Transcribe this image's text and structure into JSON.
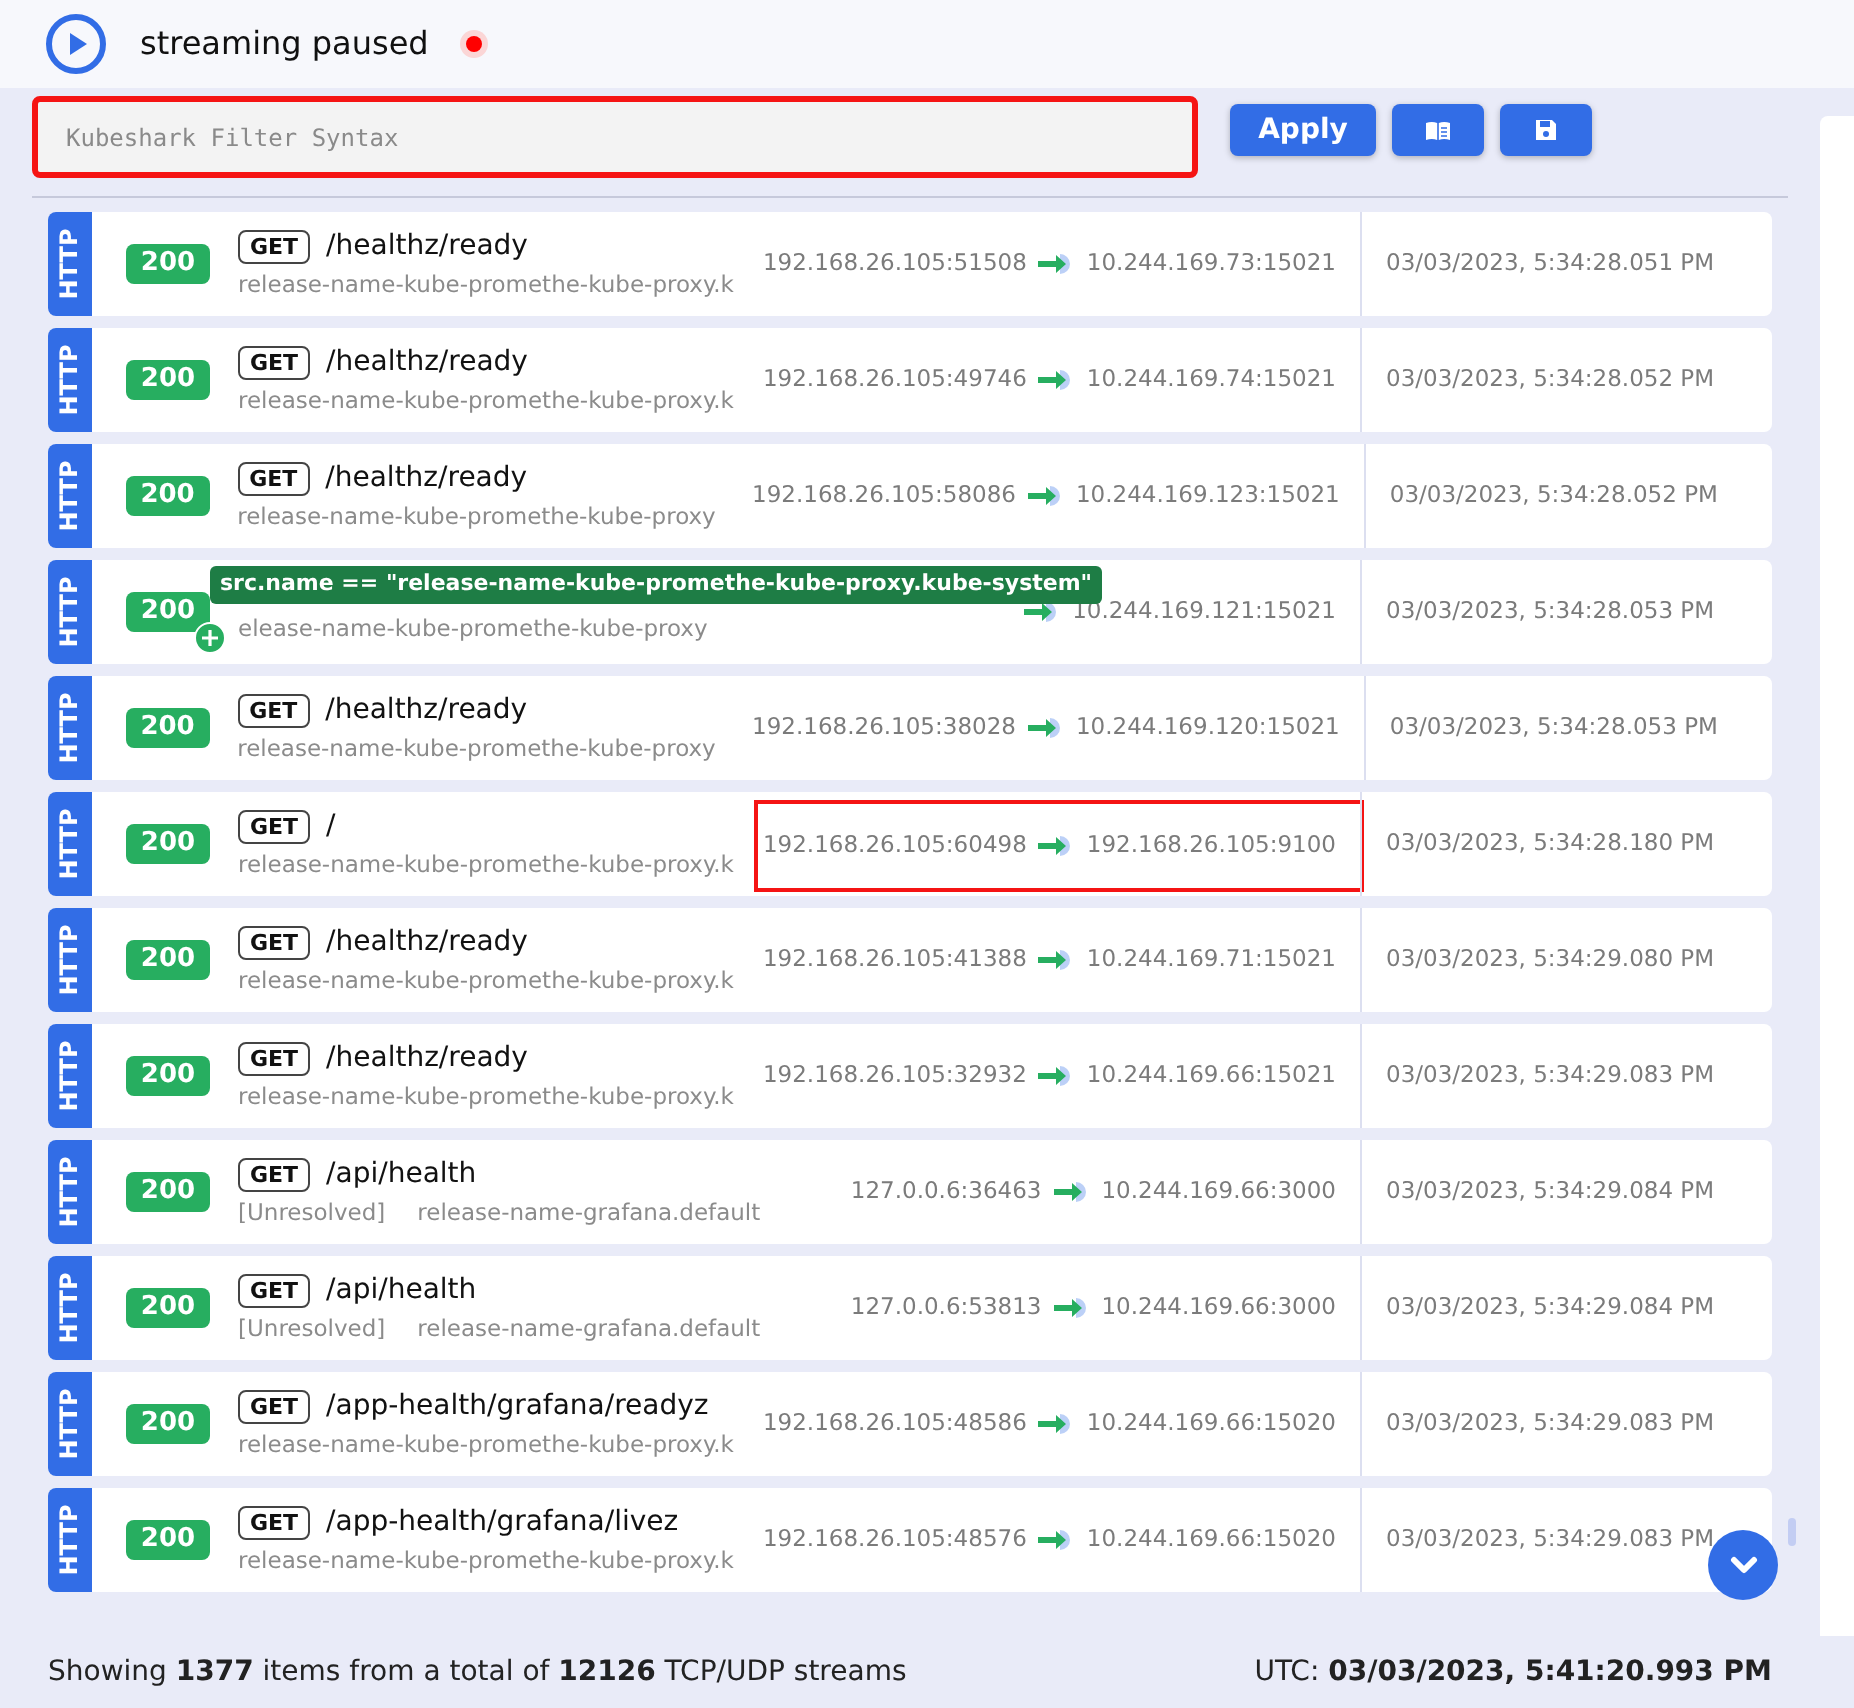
{
  "header": {
    "status_text": "streaming paused",
    "recording": true
  },
  "filter": {
    "placeholder": "Kubeshark Filter Syntax",
    "highlighted": true,
    "apply_label": "Apply"
  },
  "entries": [
    {
      "protocol": "HTTP",
      "status": "200",
      "method": "GET",
      "path": "/healthz/ready",
      "source_name": "release-name-kube-promethe-kube-proxy.k",
      "src_addr": "192.168.26.105:51508",
      "dst_addr": "10.244.169.73:15021",
      "timestamp": "03/03/2023, 5:34:28.051 PM"
    },
    {
      "protocol": "HTTP",
      "status": "200",
      "method": "GET",
      "path": "/healthz/ready",
      "source_name": "release-name-kube-promethe-kube-proxy.k",
      "src_addr": "192.168.26.105:49746",
      "dst_addr": "10.244.169.74:15021",
      "timestamp": "03/03/2023, 5:34:28.052 PM"
    },
    {
      "protocol": "HTTP",
      "status": "200",
      "method": "GET",
      "path": "/healthz/ready",
      "source_name": "release-name-kube-promethe-kube-proxy",
      "src_addr": "192.168.26.105:58086",
      "dst_addr": "10.244.169.123:15021",
      "timestamp": "03/03/2023, 5:34:28.052 PM"
    },
    {
      "protocol": "HTTP",
      "status": "200",
      "tooltip": "src.name == \"release-name-kube-promethe-kube-proxy.kube-system\"",
      "source_name": "elease-name-kube-promethe-kube-proxy",
      "dst_addr": "10.244.169.121:15021",
      "timestamp": "03/03/2023, 5:34:28.053 PM"
    },
    {
      "protocol": "HTTP",
      "status": "200",
      "method": "GET",
      "path": "/healthz/ready",
      "source_name": "release-name-kube-promethe-kube-proxy",
      "src_addr": "192.168.26.105:38028",
      "dst_addr": "10.244.169.120:15021",
      "timestamp": "03/03/2023, 5:34:28.053 PM"
    },
    {
      "protocol": "HTTP",
      "status": "200",
      "method": "GET",
      "path": "/",
      "source_name": "release-name-kube-promethe-kube-proxy.k",
      "src_addr": "192.168.26.105:60498",
      "dst_addr": "192.168.26.105:9100",
      "timestamp": "03/03/2023, 5:34:28.180 PM",
      "addr_highlighted": true
    },
    {
      "protocol": "HTTP",
      "status": "200",
      "method": "GET",
      "path": "/healthz/ready",
      "source_name": "release-name-kube-promethe-kube-proxy.k",
      "src_addr": "192.168.26.105:41388",
      "dst_addr": "10.244.169.71:15021",
      "timestamp": "03/03/2023, 5:34:29.080 PM"
    },
    {
      "protocol": "HTTP",
      "status": "200",
      "method": "GET",
      "path": "/healthz/ready",
      "source_name": "release-name-kube-promethe-kube-proxy.k",
      "src_addr": "192.168.26.105:32932",
      "dst_addr": "10.244.169.66:15021",
      "timestamp": "03/03/2023, 5:34:29.083 PM"
    },
    {
      "protocol": "HTTP",
      "status": "200",
      "method": "GET",
      "path": "/api/health",
      "source_name": "[Unresolved]",
      "dest_name": "release-name-grafana.default",
      "src_addr": "127.0.0.6:36463",
      "dst_addr": "10.244.169.66:3000",
      "timestamp": "03/03/2023, 5:34:29.084 PM"
    },
    {
      "protocol": "HTTP",
      "status": "200",
      "method": "GET",
      "path": "/api/health",
      "source_name": "[Unresolved]",
      "dest_name": "release-name-grafana.default",
      "src_addr": "127.0.0.6:53813",
      "dst_addr": "10.244.169.66:3000",
      "timestamp": "03/03/2023, 5:34:29.084 PM"
    },
    {
      "protocol": "HTTP",
      "status": "200",
      "method": "GET",
      "path": "/app-health/grafana/readyz",
      "source_name": "release-name-kube-promethe-kube-proxy.k",
      "src_addr": "192.168.26.105:48586",
      "dst_addr": "10.244.169.66:15020",
      "timestamp": "03/03/2023, 5:34:29.083 PM"
    },
    {
      "protocol": "HTTP",
      "status": "200",
      "method": "GET",
      "path": "/app-health/grafana/livez",
      "source_name": "release-name-kube-promethe-kube-proxy.k",
      "src_addr": "192.168.26.105:48576",
      "dst_addr": "10.244.169.66:15020",
      "timestamp": "03/03/2023, 5:34:29.083 PM"
    }
  ],
  "footer": {
    "summary": "Showing **1377** items from a total of **12126** TCP/UDP streams",
    "utc": "UTC: **03/03/2023, 5:41:20.993 PM**"
  }
}
